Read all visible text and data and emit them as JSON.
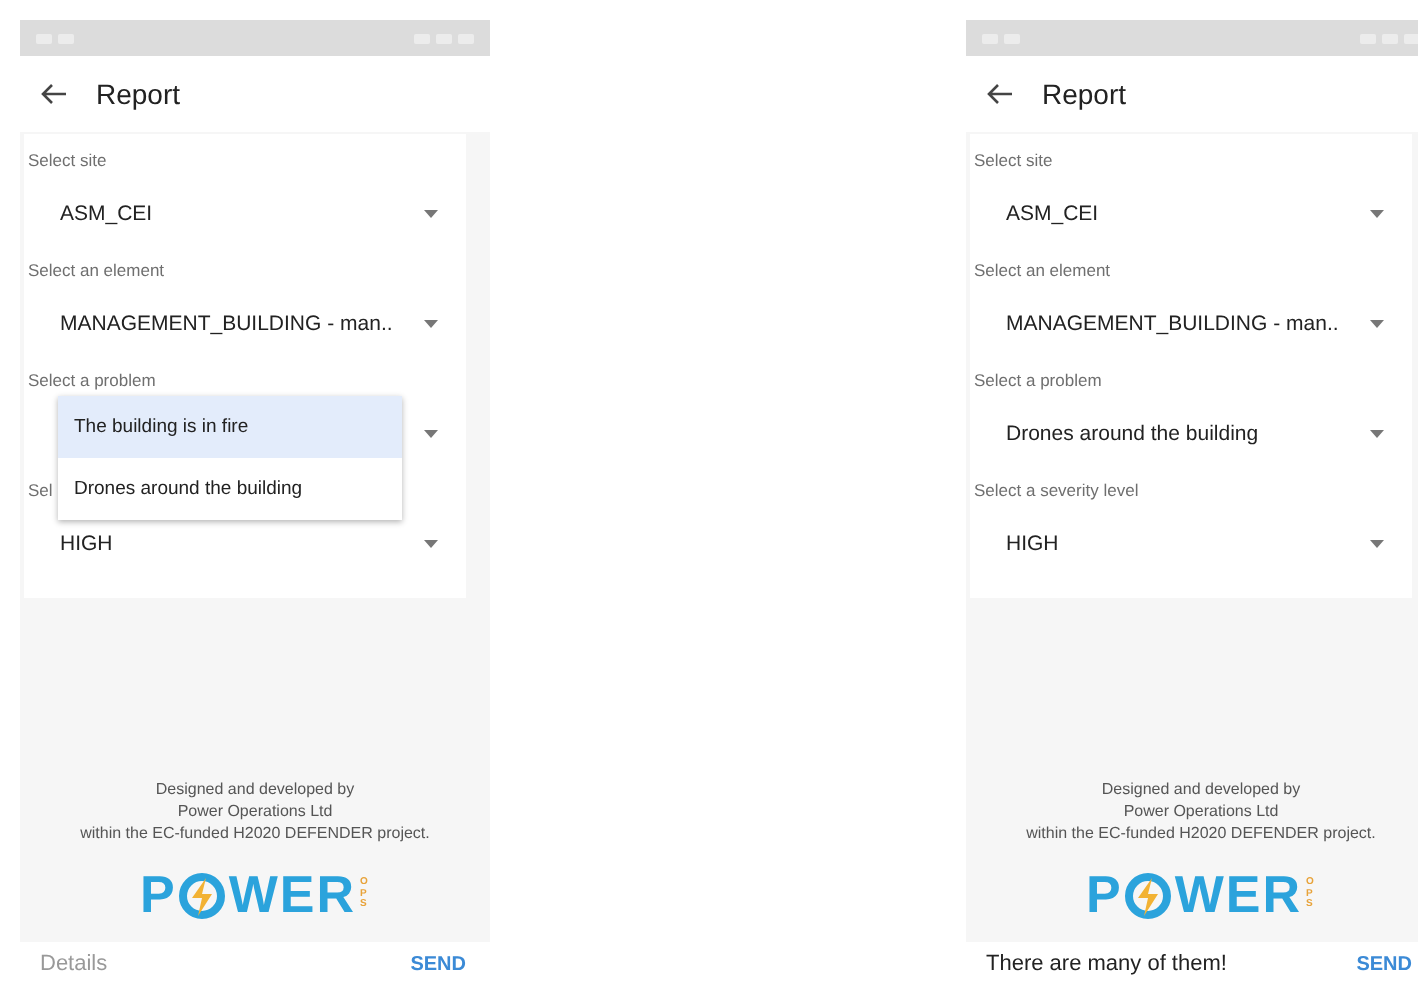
{
  "screens": [
    {
      "title": "Report",
      "fields": [
        {
          "label": "Select site",
          "value": "ASM_CEI"
        },
        {
          "label": "Select an element",
          "value": "MANAGEMENT_BUILDING - man.."
        },
        {
          "label": "Select a problem"
        },
        {
          "label": "Sel",
          "value": "HIGH"
        }
      ],
      "menu": {
        "options": [
          {
            "label": "The building is in fire",
            "selected": true
          },
          {
            "label": "Drones around the building",
            "selected": false
          }
        ]
      },
      "credits": [
        "Designed and developed by",
        "Power Operations Ltd",
        "within the EC-funded H2020 DEFENDER project."
      ],
      "logo": {
        "left": "P",
        "right": "WER",
        "tag": "OPS"
      },
      "details": {
        "placeholder": "Details"
      },
      "send": "SEND"
    },
    {
      "title": "Report",
      "fields": [
        {
          "label": "Select site",
          "value": "ASM_CEI"
        },
        {
          "label": "Select an element",
          "value": "MANAGEMENT_BUILDING - man.."
        },
        {
          "label": "Select a problem",
          "value": "Drones around the building"
        },
        {
          "label": "Select a severity level",
          "value": "HIGH"
        }
      ],
      "credits": [
        "Designed and developed by",
        "Power Operations Ltd",
        "within the EC-funded H2020 DEFENDER project."
      ],
      "logo": {
        "left": "P",
        "right": "WER",
        "tag": "OPS"
      },
      "details": {
        "value": "There are many of them!"
      },
      "send": "SEND"
    }
  ]
}
